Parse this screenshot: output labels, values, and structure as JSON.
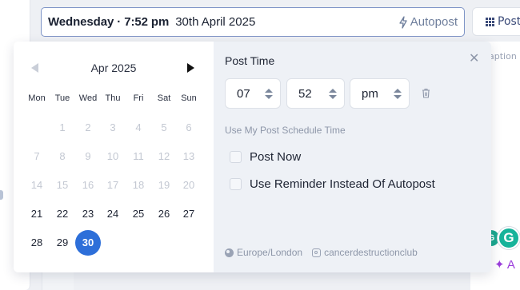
{
  "datetime_bar": {
    "day_time": "Wednesday · 7:52 pm",
    "date": "30th April 2025",
    "autopost_label": "Autopost"
  },
  "background": {
    "posts_button_label": "Post",
    "caption_label": "aption",
    "grammarly_badge": "G",
    "ai_button_label": "✦ A"
  },
  "calendar": {
    "month_label": "Apr 2025",
    "weekdays": [
      "Mon",
      "Tue",
      "Wed",
      "Thu",
      "Fri",
      "Sat",
      "Sun"
    ],
    "weeks": [
      [
        "",
        "1",
        "2",
        "3",
        "4",
        "5",
        "6"
      ],
      [
        "7",
        "8",
        "9",
        "10",
        "11",
        "12",
        "13"
      ],
      [
        "14",
        "15",
        "16",
        "17",
        "18",
        "19",
        "20"
      ],
      [
        "21",
        "22",
        "23",
        "24",
        "25",
        "26",
        "27"
      ],
      [
        "28",
        "29",
        "30",
        "",
        "",
        "",
        ""
      ]
    ],
    "selected_day": "30"
  },
  "post_time": {
    "title": "Post Time",
    "hour": "07",
    "minute": "52",
    "ampm": "pm",
    "schedule_link": "Use My Post Schedule Time",
    "post_now_label": "Post Now",
    "reminder_label": "Use Reminder Instead Of Autopost",
    "timezone": "Europe/London",
    "account": "cancerdestructionclub"
  },
  "colors": {
    "accent": "#2d6fd9",
    "border_focus": "#7f95c7",
    "muted_text": "#8e97a9",
    "panel_bg": "#eef1f6"
  }
}
